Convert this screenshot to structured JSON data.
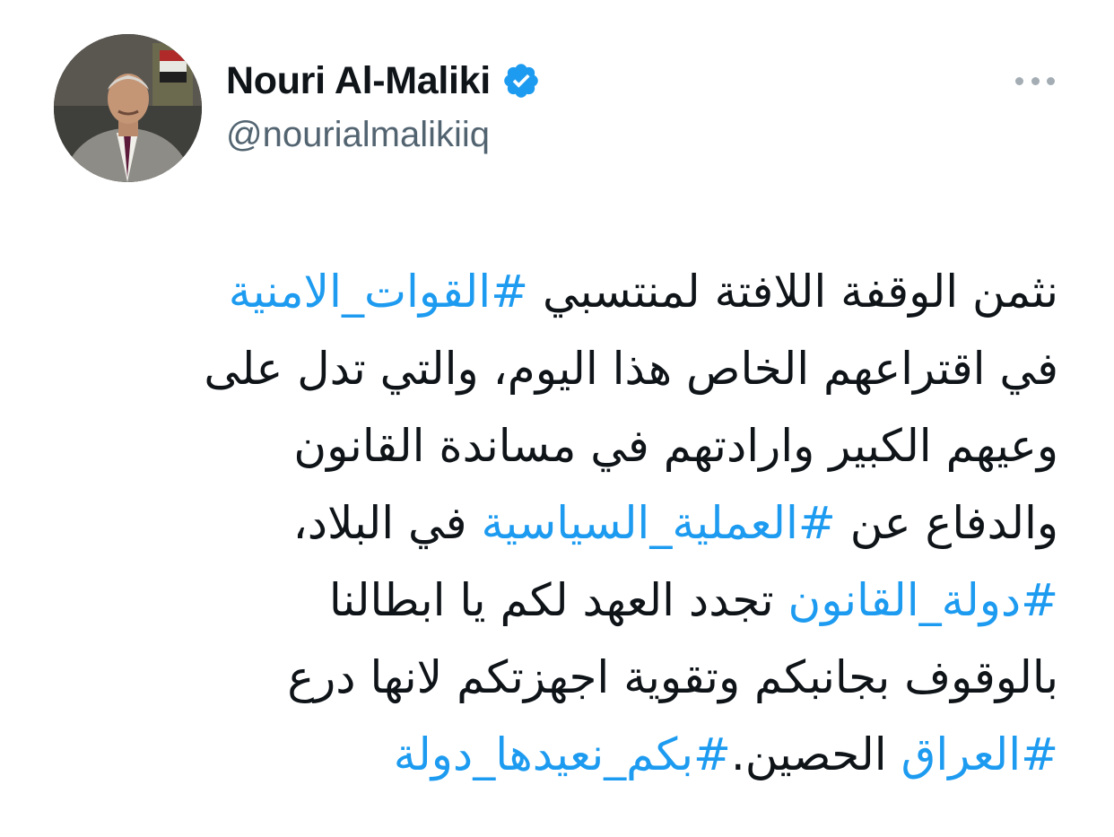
{
  "user": {
    "display_name": "Nouri Al-Maliki",
    "handle": "@nourialmalikiiq",
    "verified": true,
    "verified_icon": "verified-badge-icon",
    "verified_color": "#1d9bf0"
  },
  "more_icon": "more-options-icon",
  "colors": {
    "text": "#0f1419",
    "secondary_text": "#536471",
    "hashtag": "#1d9bf0",
    "background": "#ffffff"
  },
  "tweet": {
    "lines": [
      [
        {
          "text": "نثمن الوقفة اللافتة لمنتسبي ",
          "type": "text"
        },
        {
          "text": "#القوات_الامنية",
          "type": "hashtag"
        }
      ],
      [
        {
          "text": "في اقتراعهم الخاص هذا اليوم، والتي تدل على",
          "type": "text"
        }
      ],
      [
        {
          "text": "وعيهم الكبير وارادتهم في مساندة القانون",
          "type": "text"
        }
      ],
      [
        {
          "text": "والدفاع عن ",
          "type": "text"
        },
        {
          "text": "#العملية_السياسية",
          "type": "hashtag"
        },
        {
          "text": " في البلاد،",
          "type": "text"
        }
      ],
      [
        {
          "text": "#دولة_القانون",
          "type": "hashtag"
        },
        {
          "text": " تجدد العهد لكم يا ابطالنا",
          "type": "text"
        }
      ],
      [
        {
          "text": "بالوقوف بجانبكم وتقوية اجهزتكم لانها درع",
          "type": "text"
        }
      ],
      [
        {
          "text": "#العراق",
          "type": "hashtag"
        },
        {
          "text": " الحصين.",
          "type": "text"
        },
        {
          "text": "#بكم_نعيدها_دولة",
          "type": "hashtag"
        }
      ]
    ]
  }
}
